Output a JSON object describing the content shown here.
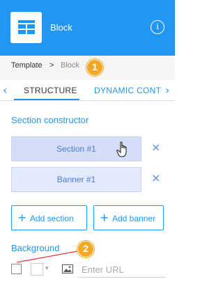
{
  "header": {
    "title": "Block",
    "info_glyph": "i",
    "background": "#2196f3"
  },
  "breadcrumb": {
    "items": [
      "Template",
      "Block"
    ],
    "separator": ">"
  },
  "markers": [
    "1",
    "2"
  ],
  "tabs": {
    "prev_arrow": "‹",
    "next_arrow": "›",
    "items": [
      "STRUCTURE",
      "DYNAMIC CONT"
    ],
    "active": "STRUCTURE"
  },
  "section_constructor": {
    "title": "Section constructor",
    "items": [
      {
        "label": "Section #1",
        "remove": "×"
      },
      {
        "label": "Banner #1",
        "remove": "×"
      }
    ],
    "add_section_label": "Add section",
    "add_banner_label": "Add banner",
    "plus_glyph": "+"
  },
  "background": {
    "title": "Background",
    "url_placeholder": "Enter URL",
    "dropdown_glyph": "▾"
  },
  "colors": {
    "accent": "#2196f3",
    "marker": "#f5a623",
    "item_bg": "#e3eafb"
  }
}
